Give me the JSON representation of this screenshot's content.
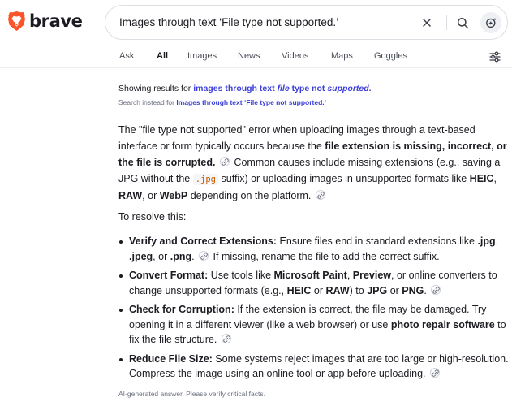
{
  "brand": {
    "name": "brave",
    "logo_color": "#fb542b"
  },
  "search": {
    "query": "Images through text ‘File type not supported.’"
  },
  "tabs": [
    {
      "label": "Ask",
      "active": false
    },
    {
      "label": "All",
      "active": true
    },
    {
      "label": "Images",
      "active": false
    },
    {
      "label": "News",
      "active": false
    },
    {
      "label": "Videos",
      "active": false
    },
    {
      "label": "Maps",
      "active": false
    },
    {
      "label": "Goggles",
      "active": false
    }
  ],
  "showing": {
    "prefix": "Showing results for ",
    "q1": "images through text ",
    "q2": "file",
    "q3": " type not ",
    "q4": "supported",
    "q5": "."
  },
  "search_instead": {
    "prefix": "Search instead for ",
    "query": "Images through text ‘File type not supported.’"
  },
  "answer": {
    "p1": {
      "t1": "The \"file type not supported\" error when uploading images through a text-based interface or form typically occurs because the ",
      "b1": "file extension is missing, incorrect, or the file is corrupted.",
      "t2": " Common causes include missing extensions (e.g., saving a JPG without the ",
      "code": ".jpg",
      "t3": " suffix) or uploading images in unsupported formats like ",
      "b2": "HEIC",
      "t4": ", ",
      "b3": "RAW",
      "t5": ", or ",
      "b4": "WebP",
      "t6": " depending on the platform."
    },
    "p2": "To resolve this:",
    "bullets": [
      {
        "title": "Verify and Correct Extensions:",
        "s1": " Ensure files end in standard extensions like ",
        "c1": ".jpg",
        "s2": ", ",
        "c2": ".jpeg",
        "s3": ", or ",
        "c3": ".png",
        "s4": ".",
        "s5": " If missing, rename the file to add the correct suffix."
      },
      {
        "title": "Convert Format:",
        "s1": " Use tools like ",
        "c1": "Microsoft Paint",
        "s2": ", ",
        "c2": "Preview",
        "s3": ", or online converters to change unsupported formats (e.g., ",
        "c3": "HEIC",
        "s4": " or ",
        "c4": "RAW",
        "s5": ") to ",
        "c5": "JPG",
        "s6": " or ",
        "c6": "PNG",
        "s7": "."
      },
      {
        "title": "Check for Corruption:",
        "s1": " If the extension is correct, the file may be damaged. Try opening it in a different viewer (like a web browser) or use ",
        "c1": "photo repair software",
        "s2": " to fix the file structure."
      },
      {
        "title": "Reduce File Size:",
        "s1": " Some systems reject images that are too large or high-resolution. Compress the image using an online tool or app before uploading."
      }
    ],
    "disclaimer": "AI-generated answer. Please verify critical facts."
  }
}
